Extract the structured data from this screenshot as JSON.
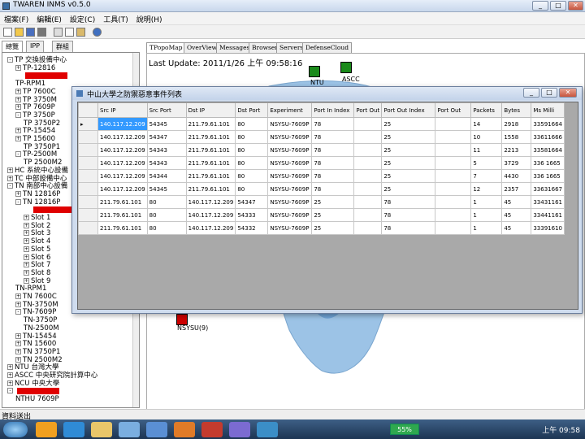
{
  "window": {
    "title": "TWAREN INMS v0.5.0",
    "btn_min": "_",
    "btn_max": "□",
    "btn_close": "✕"
  },
  "menu": [
    "檔案(F)",
    "編輯(E)",
    "設定(C)",
    "工具(T)",
    "說明(H)"
  ],
  "left_tabs": [
    "總覽",
    "IPP",
    "群組"
  ],
  "tree": [
    {
      "label": "TP 交換設備中心",
      "exp": "⊟",
      "lvl": 0
    },
    {
      "label": "TP-12816",
      "exp": "⊞",
      "lvl": 1
    },
    {
      "label": "",
      "exp": "",
      "lvl": 1,
      "red": true
    },
    {
      "label": "TP-RPM1",
      "exp": "",
      "lvl": 1
    },
    {
      "label": "TP 7600C",
      "exp": "⊞",
      "lvl": 1
    },
    {
      "label": "TP 3750M",
      "exp": "⊞",
      "lvl": 1
    },
    {
      "label": "TP 7609P",
      "exp": "⊞",
      "lvl": 1
    },
    {
      "label": "TP 3750P",
      "exp": "⊟",
      "lvl": 1
    },
    {
      "label": "TP 3750P2",
      "exp": "",
      "lvl": 2
    },
    {
      "label": "TP-15454",
      "exp": "⊞",
      "lvl": 1
    },
    {
      "label": "TP 15600",
      "exp": "⊞",
      "lvl": 1
    },
    {
      "label": "TP 3750P1",
      "exp": "",
      "lvl": 2
    },
    {
      "label": "TP-2500M",
      "exp": "⊟",
      "lvl": 1
    },
    {
      "label": "TP 2500M2",
      "exp": "",
      "lvl": 2
    },
    {
      "label": "HC 系統中心設備",
      "exp": "⊞",
      "lvl": 0
    },
    {
      "label": "TC 中部設備中心",
      "exp": "⊞",
      "lvl": 0
    },
    {
      "label": "TN 南部中心設備",
      "exp": "⊟",
      "lvl": 0
    },
    {
      "label": "TN 12816P",
      "exp": "⊞",
      "lvl": 1
    },
    {
      "label": "TN 12816P",
      "exp": "⊟",
      "lvl": 1
    },
    {
      "label": "",
      "exp": "",
      "lvl": 2,
      "red": true
    },
    {
      "label": "Slot 1",
      "exp": "⊞",
      "lvl": 2
    },
    {
      "label": "Slot 2",
      "exp": "⊞",
      "lvl": 2
    },
    {
      "label": "Slot 3",
      "exp": "⊞",
      "lvl": 2
    },
    {
      "label": "Slot 4",
      "exp": "⊞",
      "lvl": 2
    },
    {
      "label": "Slot 5",
      "exp": "⊞",
      "lvl": 2
    },
    {
      "label": "Slot 6",
      "exp": "⊞",
      "lvl": 2
    },
    {
      "label": "Slot 7",
      "exp": "⊞",
      "lvl": 2
    },
    {
      "label": "Slot 8",
      "exp": "⊞",
      "lvl": 2
    },
    {
      "label": "Slot 9",
      "exp": "⊞",
      "lvl": 2
    },
    {
      "label": "TN-RPM1",
      "exp": "",
      "lvl": 1
    },
    {
      "label": "TN 7600C",
      "exp": "⊞",
      "lvl": 1
    },
    {
      "label": "TN-3750M",
      "exp": "⊞",
      "lvl": 1
    },
    {
      "label": "TN-7609P",
      "exp": "⊟",
      "lvl": 1
    },
    {
      "label": "TN-3750P",
      "exp": "",
      "lvl": 2
    },
    {
      "label": "TN-2500M",
      "exp": "",
      "lvl": 2
    },
    {
      "label": "TN-15454",
      "exp": "⊞",
      "lvl": 1
    },
    {
      "label": "TN 15600",
      "exp": "⊞",
      "lvl": 1
    },
    {
      "label": "TN 3750P1",
      "exp": "⊞",
      "lvl": 1
    },
    {
      "label": "TN 2500M2",
      "exp": "⊞",
      "lvl": 1
    },
    {
      "label": "NTU 台灣大學",
      "exp": "⊞",
      "lvl": 0
    },
    {
      "label": "ASCC 中央研究院計算中心",
      "exp": "⊞",
      "lvl": 0
    },
    {
      "label": "NCU 中央大學",
      "exp": "⊞",
      "lvl": 0
    },
    {
      "label": "",
      "exp": "⊟",
      "lvl": 0,
      "red": true
    },
    {
      "label": "NTHU 7609P",
      "exp": "",
      "lvl": 1
    }
  ],
  "right_tabs": [
    "TPopoMap",
    "OverView",
    "Messages",
    "Browser",
    "Servers",
    "DefenseCloud"
  ],
  "map": {
    "last_update": "Last Update: 2011/1/26 上午 09:58:16",
    "nodes": [
      {
        "label": "NTU",
        "color": "#1a8a1a"
      },
      {
        "label": "ASCC",
        "color": "#1a8a1a"
      },
      {
        "label": "NSYSU(9)",
        "color": "#cc0000"
      }
    ]
  },
  "dialog": {
    "title": "中山大學之防禦惡意事件列表",
    "columns": [
      "Src IP",
      "Src Port",
      "Dst IP",
      "Dst Port",
      "Experiment",
      "Port In Index",
      "Port Out",
      "Port Out Index",
      "Port Out",
      "Packets",
      "Bytes",
      "Ms Milli"
    ],
    "rows": [
      [
        "140.117.12.209",
        "54345",
        "211.79.61.101",
        "80",
        "NSYSU-7609P",
        "78",
        "",
        "25",
        "",
        "14",
        "2918",
        "33591664"
      ],
      [
        "140.117.12.209",
        "54347",
        "211.79.61.101",
        "80",
        "NSYSU-7609P",
        "78",
        "",
        "25",
        "",
        "10",
        "1558",
        "33611666"
      ],
      [
        "140.117.12.209",
        "54343",
        "211.79.61.101",
        "80",
        "NSYSU-7609P",
        "78",
        "",
        "25",
        "",
        "11",
        "2213",
        "33581664"
      ],
      [
        "140.117.12.209",
        "54343",
        "211.79.61.101",
        "80",
        "NSYSU-7609P",
        "78",
        "",
        "25",
        "",
        "5",
        "3729",
        "336 1665"
      ],
      [
        "140.117.12.209",
        "54344",
        "211.79.61.101",
        "80",
        "NSYSU-7609P",
        "78",
        "",
        "25",
        "",
        "7",
        "4430",
        "336 1665"
      ],
      [
        "140.117.12.209",
        "54345",
        "211.79.61.101",
        "80",
        "NSYSU-7609P",
        "78",
        "",
        "25",
        "",
        "12",
        "2357",
        "33631667"
      ],
      [
        "211.79.61.101",
        "80",
        "140.117.12.209",
        "54347",
        "NSYSU-7609P",
        "25",
        "",
        "78",
        "",
        "1",
        "45",
        "33431161"
      ],
      [
        "211.79.61.101",
        "80",
        "140.117.12.209",
        "54333",
        "NSYSU-7609P",
        "25",
        "",
        "78",
        "",
        "1",
        "45",
        "33441161"
      ],
      [
        "211.79.61.101",
        "80",
        "140.117.12.209",
        "54332",
        "NSYSU-7609P",
        "25",
        "",
        "78",
        "",
        "1",
        "45",
        "33391610"
      ]
    ]
  },
  "status_text": "資料送出",
  "taskbar": {
    "battery": "55%",
    "clock": "上午 09:58"
  }
}
